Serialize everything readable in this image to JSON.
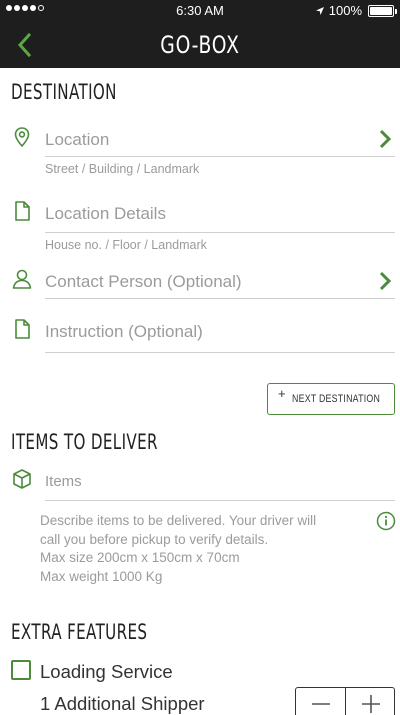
{
  "status_bar": {
    "time": "6:30 AM",
    "battery": "100%",
    "battery_level": 1.0,
    "signal_bars": 4
  },
  "nav": {
    "title": "GO-BOX",
    "back_icon": "chevron-left-icon"
  },
  "destination": {
    "title": "DESTINATION",
    "fields": [
      {
        "label": "Location",
        "hint": "Street / Building / Landmark",
        "icon": "location-pin-icon",
        "has_chevron": true
      },
      {
        "label": "Location Details",
        "hint": "House no. / Floor / Landmark",
        "icon": "document-icon",
        "has_chevron": false
      },
      {
        "label": "Contact Person (Optional)",
        "hint": "",
        "icon": "person-icon",
        "has_chevron": true
      },
      {
        "label": "Instruction (Optional)",
        "hint": "",
        "icon": "document-icon",
        "has_chevron": false
      }
    ],
    "next_button": {
      "plus": "+",
      "label": "NEXT DESTINATION"
    }
  },
  "items": {
    "title": "ITEMS TO DELIVER",
    "field_label": "Items",
    "field_icon": "box-icon",
    "description_lines": [
      "Describe items to be delivered. Your driver will",
      "call you before pickup to verify details.",
      "Max size 200cm x 150cm x 70cm",
      "Max weight 1000 Kg"
    ],
    "info_icon": "info-icon"
  },
  "extra": {
    "title": "EXTRA FEATURES",
    "loading_service_label": "Loading Service",
    "loading_service_checked": false,
    "additional_shipper_label": "1 Additional Shipper"
  },
  "colors": {
    "accent": "#4a8c3a",
    "nav_bg": "#1e1e1e",
    "muted_text": "#9b9b9b"
  }
}
